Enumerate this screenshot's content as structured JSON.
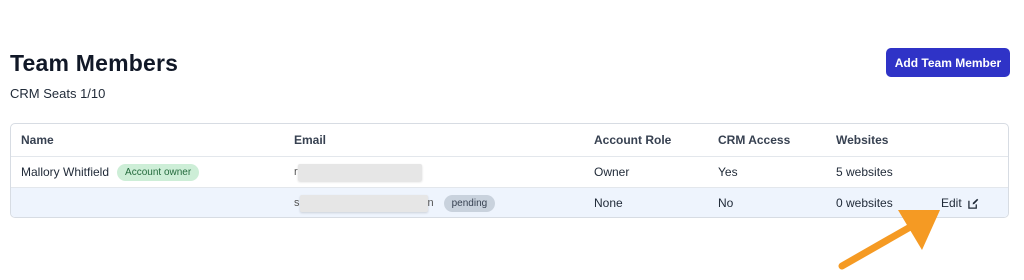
{
  "header": {
    "title": "Team Members",
    "seats": "CRM Seats 1/10",
    "add_button_label": "Add Team Member"
  },
  "table": {
    "columns": {
      "name": "Name",
      "email": "Email",
      "role": "Account Role",
      "crm": "CRM Access",
      "websites": "Websites"
    },
    "rows": [
      {
        "name": "Mallory Whitfield",
        "badge": "Account owner",
        "email_prefix": "r",
        "email_suffix": "",
        "role": "Owner",
        "crm": "Yes",
        "websites": "5 websites"
      },
      {
        "name": "",
        "status": "pending",
        "email_prefix": "s",
        "email_suffix": "n",
        "role": "None",
        "crm": "No",
        "websites": "0 websites",
        "edit_label": "Edit"
      }
    ]
  },
  "colors": {
    "primary_button": "#2f33c7",
    "owner_badge_bg": "#cdeed7",
    "pending_badge_bg": "#c9d2dd",
    "highlight_row": "#eef4fd",
    "annotation_arrow": "#f59a23"
  },
  "icons": {
    "edit": "edit-icon",
    "annotation": "arrow-annotation"
  }
}
